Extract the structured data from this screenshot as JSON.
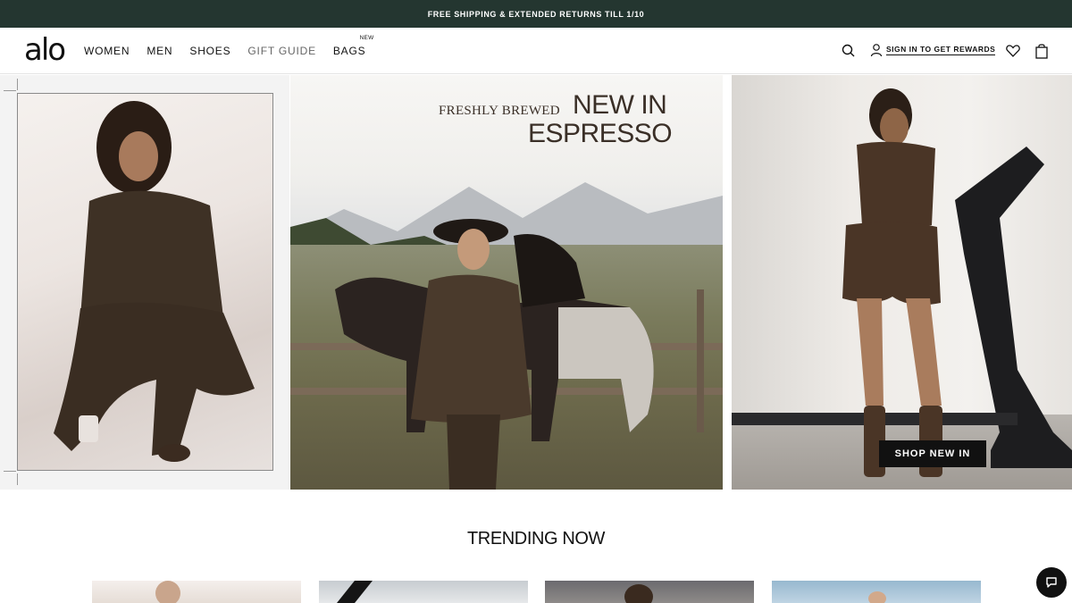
{
  "announcement": "FREE SHIPPING & EXTENDED RETURNS TILL 1/10",
  "header": {
    "logo": "alo",
    "nav": [
      {
        "label": "WOMEN"
      },
      {
        "label": "MEN"
      },
      {
        "label": "SHOES"
      },
      {
        "label": "GIFT GUIDE"
      },
      {
        "label": "BAGS",
        "badge": "NEW"
      }
    ],
    "search_icon": "search-icon",
    "signin_label": "SIGN IN TO GET REWARDS",
    "user_icon": "user-icon",
    "wishlist_icon": "heart-icon",
    "bag_icon": "shopping-bag-icon"
  },
  "hero": {
    "headline_small": "FRESHLY BREWED",
    "headline_line1": "NEW IN",
    "headline_line2": "ESPRESSO",
    "cta_label": "SHOP NEW IN",
    "colors": {
      "text": "#3a2f27",
      "outfit": "#4a3a2c"
    }
  },
  "section_title": "TRENDING NOW",
  "trending_tiles": 4,
  "chat_icon": "chat-bubble-icon",
  "colors": {
    "announce_bg": "#243630",
    "cta_bg": "#111111"
  }
}
